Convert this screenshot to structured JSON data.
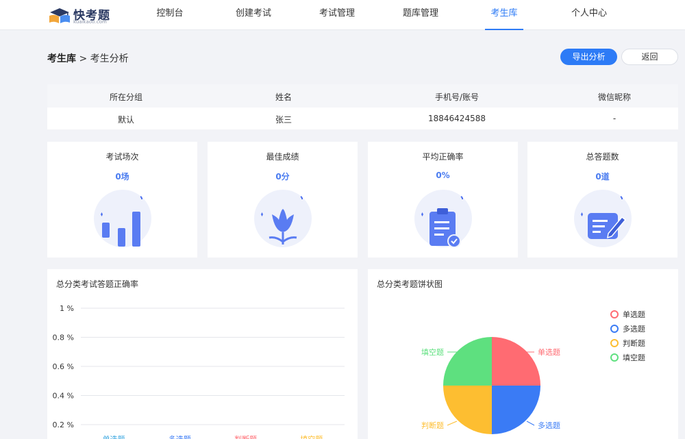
{
  "brand": {
    "name": "快考题",
    "domain": "kuaikaoti.com"
  },
  "nav": [
    {
      "label": "控制台",
      "active": false
    },
    {
      "label": "创建考试",
      "active": false
    },
    {
      "label": "考试管理",
      "active": false
    },
    {
      "label": "题库管理",
      "active": false
    },
    {
      "label": "考生库",
      "active": true
    },
    {
      "label": "个人中心",
      "active": false
    }
  ],
  "breadcrumb": {
    "root": "考生库",
    "separator": ">",
    "current": "考生分析"
  },
  "actions": {
    "export": "导出分析",
    "back": "返回"
  },
  "student_table": {
    "headers": [
      "所在分组",
      "姓名",
      "手机号/账号",
      "微信昵称"
    ],
    "row": [
      "默认",
      "张三",
      "18846424588",
      "-"
    ]
  },
  "stats": [
    {
      "title": "考试场次",
      "value": "0场",
      "icon": "bar-chart-icon"
    },
    {
      "title": "最佳成绩",
      "value": "0分",
      "icon": "tulip-icon"
    },
    {
      "title": "平均正确率",
      "value": "0%",
      "icon": "clipboard-check-icon"
    },
    {
      "title": "总答题数",
      "value": "0道",
      "icon": "notepad-pen-icon"
    }
  ],
  "accuracy_panel": {
    "title": "总分类考试答题正确率"
  },
  "pie_panel": {
    "title": "总分类考题饼状图"
  },
  "colors": {
    "accent": "#2d7bf6",
    "stat_value": "#4a7cf0",
    "single": "#ff6b72",
    "multi": "#3a7bf5",
    "judge": "#fdbe31",
    "fill": "#5ee07f"
  },
  "chart_data": [
    {
      "type": "bar",
      "categories": [
        "单选题",
        "多选题",
        "判断题",
        "填空题"
      ],
      "category_colors": [
        "#3ba7e0",
        "#3a7bf5",
        "#ff6b72",
        "#fdbe31"
      ],
      "values": [
        0,
        0,
        0,
        0
      ],
      "y_ticks": [
        "0.2 %",
        "0.4 %",
        "0.6 %",
        "0.8 %",
        "1 %"
      ],
      "ylim": [
        0,
        1
      ],
      "grid": true,
      "title": "总分类考试答题正确率"
    },
    {
      "type": "pie",
      "title": "总分类考题饼状图",
      "slices": [
        {
          "name": "单选题",
          "value": 25,
          "color": "#ff6b72"
        },
        {
          "name": "多选题",
          "value": 25,
          "color": "#3a7bf5"
        },
        {
          "name": "判断题",
          "value": 25,
          "color": "#fdbe31"
        },
        {
          "name": "填空题",
          "value": 25,
          "color": "#5ee07f"
        }
      ],
      "legend": "top-right"
    }
  ]
}
